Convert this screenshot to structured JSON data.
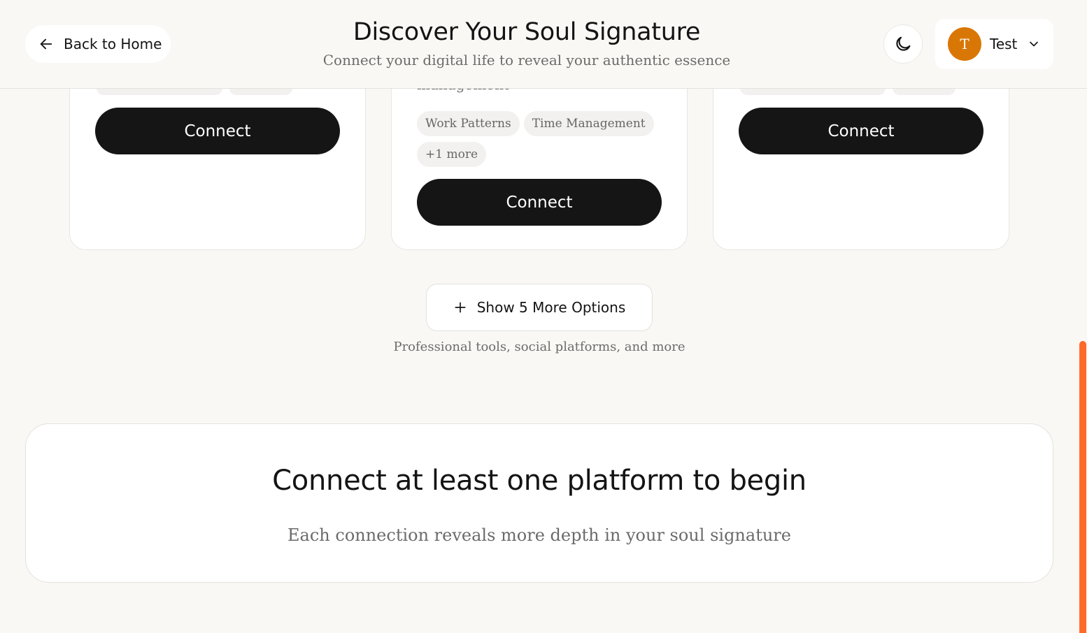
{
  "header": {
    "back_label": "Back to Home",
    "title": "Discover Your Soul Signature",
    "subtitle": "Connect your digital life to reveal your authentic essence",
    "theme_icon": "moon-icon",
    "user": {
      "initial": "T",
      "name": "Test",
      "avatar_color": "#d97706"
    }
  },
  "cards": [
    {
      "connect_label": "Connect"
    },
    {
      "description_partial": "management",
      "tags": [
        "Work Patterns",
        "Time Management",
        "+1 more"
      ],
      "connect_label": "Connect"
    },
    {
      "connect_label": "Connect"
    }
  ],
  "show_more": {
    "label": "Show 5 More Options",
    "hint": "Professional tools, social platforms, and more"
  },
  "cta": {
    "title": "Connect at least one platform to begin",
    "subtitle": "Each connection reveals more depth in your soul signature"
  },
  "colors": {
    "accent": "#ff6a2a",
    "button_dark": "#151515",
    "background": "#faf8f5"
  }
}
